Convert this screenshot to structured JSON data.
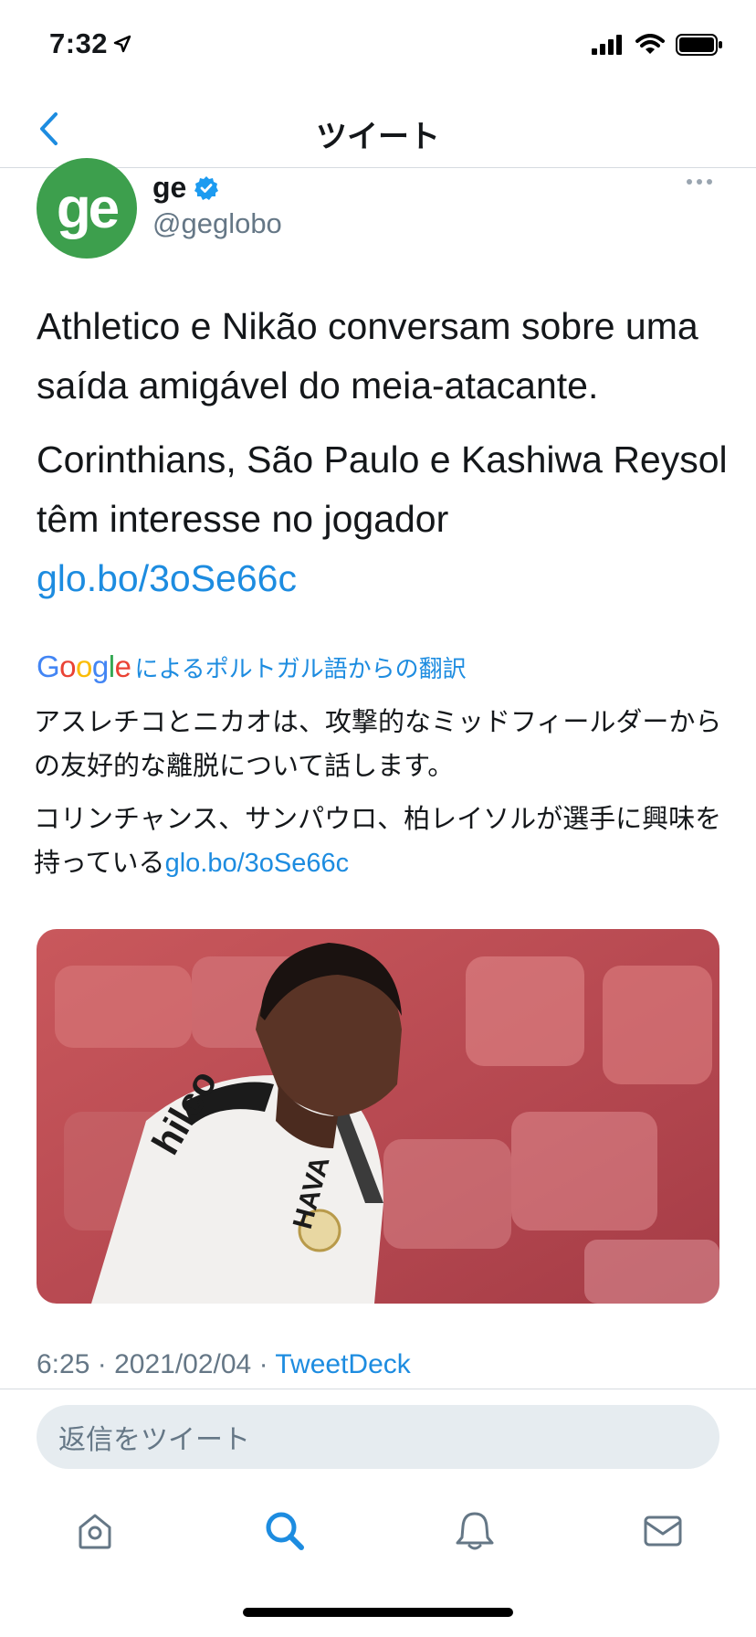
{
  "status_bar": {
    "time": "7:32"
  },
  "nav": {
    "title": "ツイート"
  },
  "tweet": {
    "author": {
      "avatar_text": "ge",
      "display_name": "ge",
      "handle": "@geglobo",
      "verified": true
    },
    "text_paragraph_1": "Athletico e Nikão conversam sobre uma saída amigável do meia-atacante.",
    "text_paragraph_2": "Corinthians, São Paulo e Kashiwa Reysol têm interesse no jogador",
    "link": "glo.bo/3oSe66c",
    "translation": {
      "provider": "Google",
      "label": "によるポルトガル語からの翻訳",
      "paragraph_1": "アスレチコとニカオは、攻撃的なミッドフィールダーからの友好的な離脱について話します。",
      "paragraph_2": "コリンチャンス、サンパウロ、柏レイソルが選手に興味を持っている",
      "link": "glo.bo/3oSe66c"
    },
    "media_alt": "player photo",
    "meta": {
      "time": "6:25",
      "date": "2021/02/04",
      "separator": "·",
      "source": "TweetDeck"
    }
  },
  "reply": {
    "placeholder": "返信をツイート"
  },
  "tabs": [
    {
      "name": "home",
      "icon": "home-icon"
    },
    {
      "name": "search",
      "icon": "search-icon"
    },
    {
      "name": "notifications",
      "icon": "bell-icon"
    },
    {
      "name": "messages",
      "icon": "mail-icon"
    }
  ],
  "colors": {
    "accent": "#1d8ce0",
    "avatar_bg": "#3d9f4d",
    "muted": "#657786"
  }
}
